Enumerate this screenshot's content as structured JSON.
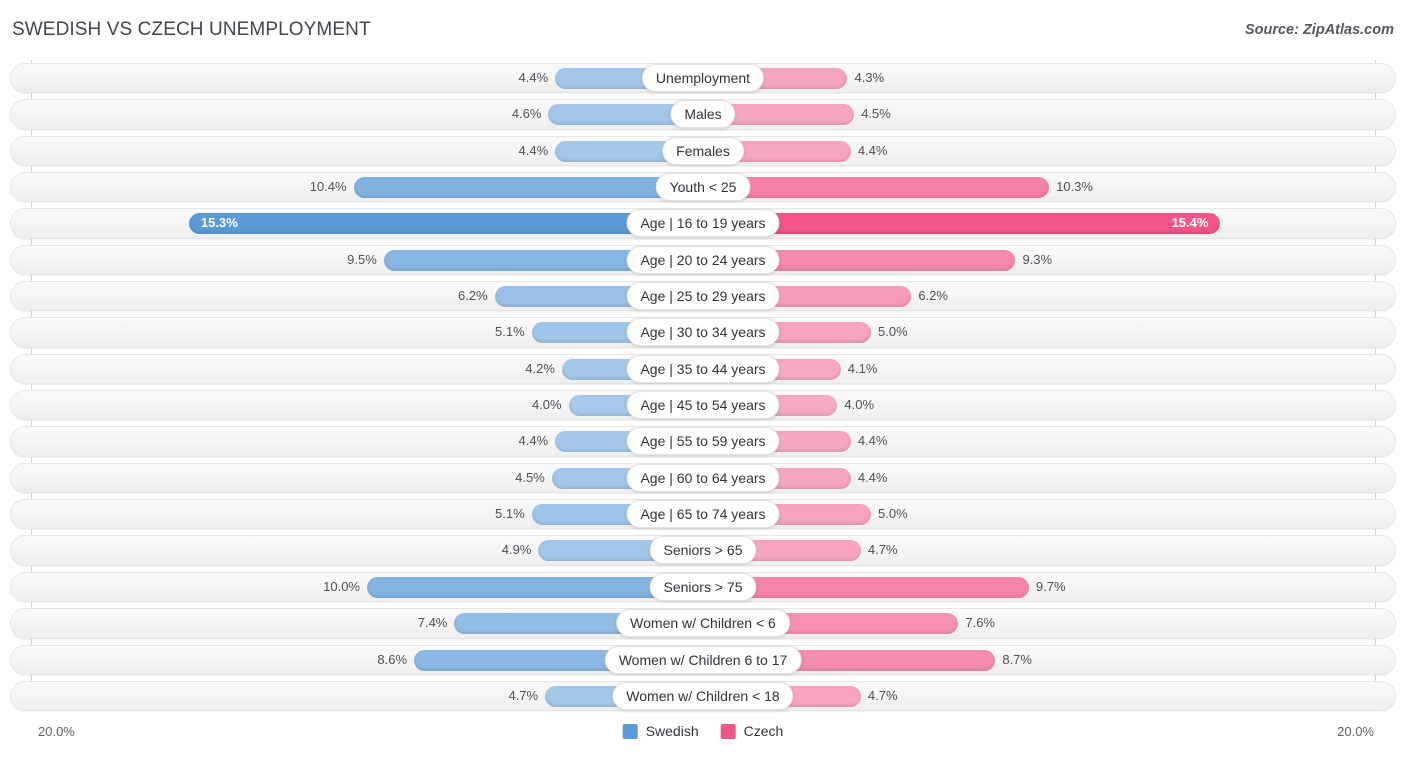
{
  "header": {
    "title": "SWEDISH VS CZECH UNEMPLOYMENT",
    "source": "Source: ZipAtlas.com"
  },
  "axis": {
    "left_tick": "20.0%",
    "right_tick": "20.0%",
    "max": 20.0
  },
  "legend": {
    "items": [
      {
        "label": "Swedish",
        "color": "#5B9BD5"
      },
      {
        "label": "Czech",
        "color": "#F2548B"
      }
    ]
  },
  "colors": {
    "left_base": "#A5C9EA",
    "left_highlight": "#5B9BD5",
    "right_base": "#F6A8C4",
    "right_highlight": "#F2548B",
    "track": "#F4F4F4",
    "gridline": "#D4D4D4"
  },
  "chart_data": {
    "type": "bar",
    "orientation": "horizontal-diverging",
    "title": "SWEDISH VS CZECH UNEMPLOYMENT",
    "subtitle": "Source: ZipAtlas.com",
    "xlabel": "",
    "ylabel": "",
    "xlim": [
      -20.0,
      20.0
    ],
    "axis_tick_labels": [
      "20.0%",
      "20.0%"
    ],
    "grid": true,
    "legend_position": "bottom-center",
    "series": [
      {
        "name": "Swedish",
        "side": "left",
        "color": "#A5C9EA",
        "values": [
          4.4,
          4.6,
          4.4,
          10.4,
          15.3,
          9.5,
          6.2,
          5.1,
          4.2,
          4.0,
          4.4,
          4.5,
          5.1,
          4.9,
          10.0,
          7.4,
          8.6,
          4.7
        ],
        "labels": [
          "4.4%",
          "4.6%",
          "4.4%",
          "10.4%",
          "15.3%",
          "9.5%",
          "6.2%",
          "5.1%",
          "4.2%",
          "4.0%",
          "4.4%",
          "4.5%",
          "5.1%",
          "4.9%",
          "10.0%",
          "7.4%",
          "8.6%",
          "4.7%"
        ]
      },
      {
        "name": "Czech",
        "side": "right",
        "color": "#F6A8C4",
        "values": [
          4.3,
          4.5,
          4.4,
          10.3,
          15.4,
          9.3,
          6.2,
          5.0,
          4.1,
          4.0,
          4.4,
          4.4,
          5.0,
          4.7,
          9.7,
          7.6,
          8.7,
          4.7
        ],
        "labels": [
          "4.3%",
          "4.5%",
          "4.4%",
          "10.3%",
          "15.4%",
          "9.3%",
          "6.2%",
          "5.0%",
          "4.1%",
          "4.0%",
          "4.4%",
          "4.4%",
          "5.0%",
          "4.7%",
          "9.7%",
          "7.6%",
          "8.7%",
          "4.7%"
        ]
      }
    ],
    "categories": [
      "Unemployment",
      "Males",
      "Females",
      "Youth < 25",
      "Age | 16 to 19 years",
      "Age | 20 to 24 years",
      "Age | 25 to 29 years",
      "Age | 30 to 34 years",
      "Age | 35 to 44 years",
      "Age | 45 to 54 years",
      "Age | 55 to 59 years",
      "Age | 60 to 64 years",
      "Age | 65 to 74 years",
      "Seniors > 65",
      "Seniors > 75",
      "Women w/ Children < 6",
      "Women w/ Children 6 to 17",
      "Women w/ Children < 18"
    ],
    "highlighted_row": "Age | 16 to 19 years"
  },
  "rows": [
    {
      "label": "Unemployment",
      "left": 4.4,
      "right": 4.3,
      "left_label": "4.4%",
      "right_label": "4.3%",
      "highlight": false
    },
    {
      "label": "Males",
      "left": 4.6,
      "right": 4.5,
      "left_label": "4.6%",
      "right_label": "4.5%",
      "highlight": false
    },
    {
      "label": "Females",
      "left": 4.4,
      "right": 4.4,
      "left_label": "4.4%",
      "right_label": "4.4%",
      "highlight": false
    },
    {
      "label": "Youth < 25",
      "left": 10.4,
      "right": 10.3,
      "left_label": "10.4%",
      "right_label": "10.3%",
      "highlight": false
    },
    {
      "label": "Age | 16 to 19 years",
      "left": 15.3,
      "right": 15.4,
      "left_label": "15.3%",
      "right_label": "15.4%",
      "highlight": true
    },
    {
      "label": "Age | 20 to 24 years",
      "left": 9.5,
      "right": 9.3,
      "left_label": "9.5%",
      "right_label": "9.3%",
      "highlight": false
    },
    {
      "label": "Age | 25 to 29 years",
      "left": 6.2,
      "right": 6.2,
      "left_label": "6.2%",
      "right_label": "6.2%",
      "highlight": false
    },
    {
      "label": "Age | 30 to 34 years",
      "left": 5.1,
      "right": 5.0,
      "left_label": "5.1%",
      "right_label": "5.0%",
      "highlight": false
    },
    {
      "label": "Age | 35 to 44 years",
      "left": 4.2,
      "right": 4.1,
      "left_label": "4.2%",
      "right_label": "4.1%",
      "highlight": false
    },
    {
      "label": "Age | 45 to 54 years",
      "left": 4.0,
      "right": 4.0,
      "left_label": "4.0%",
      "right_label": "4.0%",
      "highlight": false
    },
    {
      "label": "Age | 55 to 59 years",
      "left": 4.4,
      "right": 4.4,
      "left_label": "4.4%",
      "right_label": "4.4%",
      "highlight": false
    },
    {
      "label": "Age | 60 to 64 years",
      "left": 4.5,
      "right": 4.4,
      "left_label": "4.5%",
      "right_label": "4.4%",
      "highlight": false
    },
    {
      "label": "Age | 65 to 74 years",
      "left": 5.1,
      "right": 5.0,
      "left_label": "5.1%",
      "right_label": "5.0%",
      "highlight": false
    },
    {
      "label": "Seniors > 65",
      "left": 4.9,
      "right": 4.7,
      "left_label": "4.9%",
      "right_label": "4.7%",
      "highlight": false
    },
    {
      "label": "Seniors > 75",
      "left": 10.0,
      "right": 9.7,
      "left_label": "10.0%",
      "right_label": "9.7%",
      "highlight": false
    },
    {
      "label": "Women w/ Children < 6",
      "left": 7.4,
      "right": 7.6,
      "left_label": "7.4%",
      "right_label": "7.6%",
      "highlight": false
    },
    {
      "label": "Women w/ Children 6 to 17",
      "left": 8.6,
      "right": 8.7,
      "left_label": "8.6%",
      "right_label": "8.7%",
      "highlight": false
    },
    {
      "label": "Women w/ Children < 18",
      "left": 4.7,
      "right": 4.7,
      "left_label": "4.7%",
      "right_label": "4.7%",
      "highlight": false
    }
  ]
}
